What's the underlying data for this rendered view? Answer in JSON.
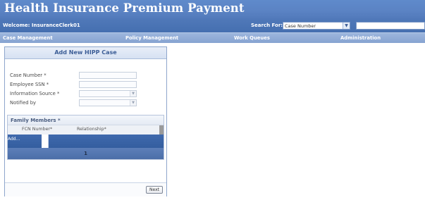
{
  "header": {
    "title": "Health Insurance Premium Payment",
    "welcome": "Welcome: InsuranceClerk01",
    "search_label": "Search For:",
    "search_type": "Case Number",
    "search_value": ""
  },
  "nav": [
    {
      "label": "Case Management"
    },
    {
      "label": "Policy Management"
    },
    {
      "label": "Work Queues"
    },
    {
      "label": "Administration"
    }
  ],
  "panel": {
    "title": "Add New HIPP Case",
    "fields": [
      {
        "label": "Case Number *",
        "value": ""
      },
      {
        "label": "Employee SSN *",
        "value": ""
      },
      {
        "label": "Information Source *",
        "value": ""
      },
      {
        "label": "Notified by",
        "value": ""
      }
    ],
    "family": {
      "title": "Family Members *",
      "columns": [
        "FCN Number*",
        "Relationship*"
      ],
      "add_label": "Add...",
      "page": "1"
    },
    "next_label": "Next"
  },
  "colors": {
    "header": "#5b83c4",
    "nav": "#8ea9d4",
    "accent": "#3b5d96",
    "grid_fill": "#3f69ad"
  },
  "icons": {
    "dropdown": "chevron-down-icon"
  }
}
